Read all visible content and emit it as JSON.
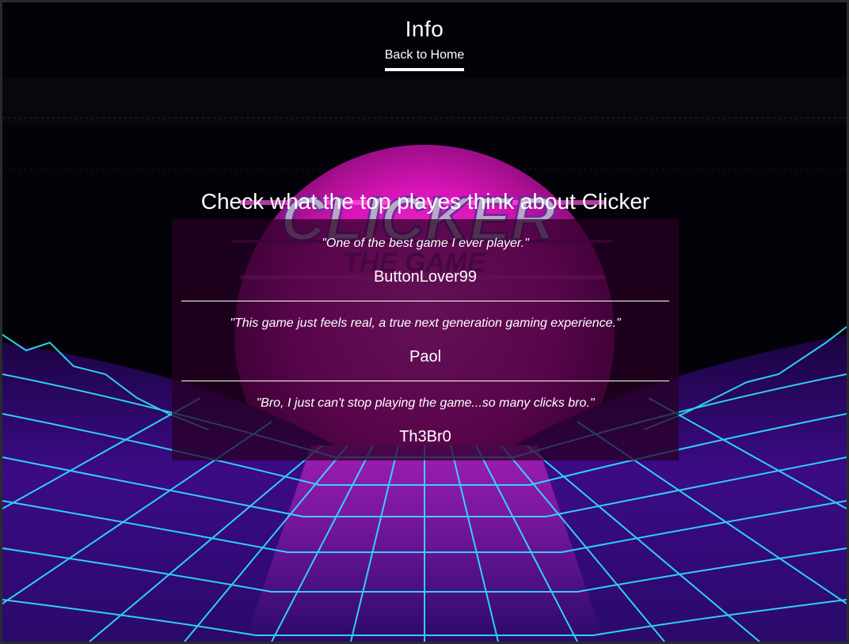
{
  "header": {
    "title": "Info",
    "back_link": "Back to Home"
  },
  "main": {
    "heading": "Check what the top playes think about Clicker",
    "reviews": [
      {
        "quote": "\"One of the best game I ever player.\"",
        "author": "ButtonLover99"
      },
      {
        "quote": "\"This game just feels real, a true next generation gaming experience.\"",
        "author": "Paol"
      },
      {
        "quote": "\"Bro, I just can't stop playing the game...so many clicks bro.\"",
        "author": "Th3Br0"
      }
    ]
  },
  "background": {
    "logo_text": "CLICKER",
    "logo_subtext": "THE GAME",
    "sun_color": "#ff1fd0",
    "grid_color": "#2ee6ff",
    "ground_color": "#3a0a8a"
  }
}
